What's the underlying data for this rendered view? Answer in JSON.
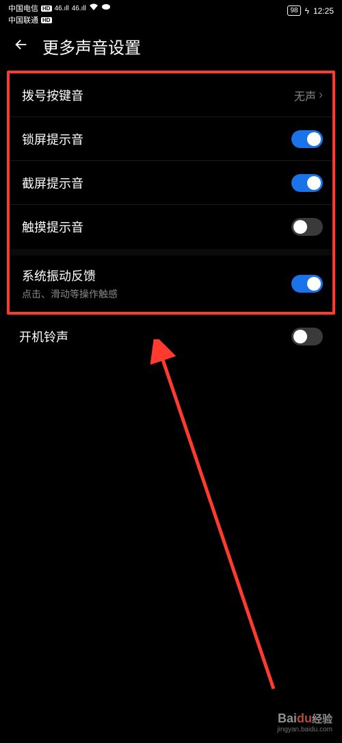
{
  "status": {
    "carrier1": "中国电信",
    "carrier2": "中国联通",
    "badge": "HD",
    "signal": "46.ıll",
    "battery": "98",
    "time": "12:25"
  },
  "header": {
    "title": "更多声音设置"
  },
  "settings": {
    "dial_tone": {
      "label": "拨号按键音",
      "value": "无声"
    },
    "lock_sound": {
      "label": "锁屏提示音",
      "on": true
    },
    "screenshot_sound": {
      "label": "截屏提示音",
      "on": true
    },
    "touch_sound": {
      "label": "触摸提示音",
      "on": false
    },
    "haptic": {
      "label": "系统振动反馈",
      "sublabel": "点击、滑动等操作触感",
      "on": true
    },
    "boot_sound": {
      "label": "开机铃声",
      "on": false
    }
  },
  "watermark": {
    "brand_prefix": "Bai",
    "brand_du": "du",
    "brand_suffix": "经验",
    "url": "jingyan.baidu.com"
  }
}
